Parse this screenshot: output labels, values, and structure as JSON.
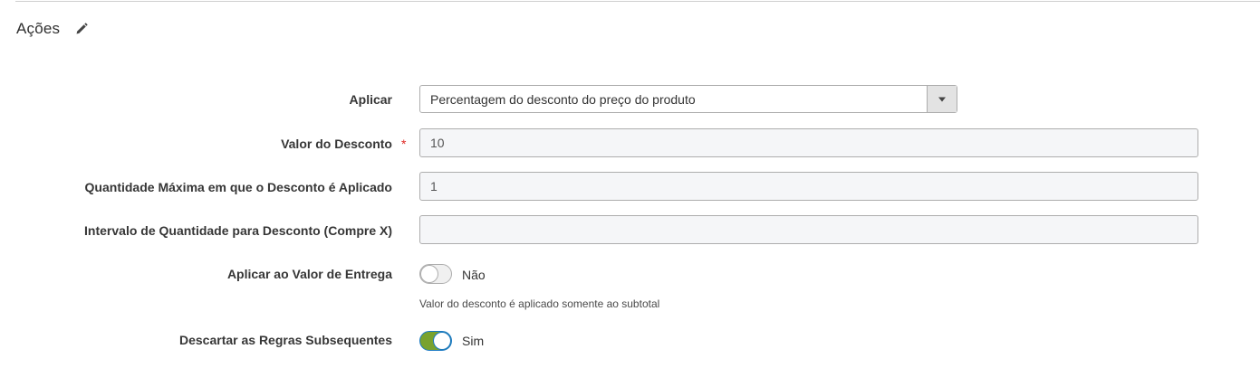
{
  "section": {
    "title": "Ações",
    "edit_icon": "pencil-icon"
  },
  "fields": {
    "apply": {
      "label": "Aplicar",
      "value": "Percentagem do desconto do preço do produto",
      "arrow_icon": "caret-down-icon"
    },
    "discount_amount": {
      "label": "Valor do Desconto",
      "required_mark": "*",
      "value": "10"
    },
    "max_qty": {
      "label": "Quantidade Máxima em que o Desconto é Aplicado",
      "value": "1"
    },
    "discount_step": {
      "label": "Intervalo de Quantidade para Desconto (Compre X)",
      "value": ""
    },
    "apply_to_shipping": {
      "label": "Aplicar ao Valor de Entrega",
      "state": "off",
      "state_label": "Não",
      "note": "Valor do desconto é aplicado somente ao subtotal"
    },
    "discard_subsequent": {
      "label": "Descartar as Regras Subsequentes",
      "state": "on",
      "state_label": "Sim"
    }
  },
  "colors": {
    "toggle_on": "#79a22e",
    "toggle_on_border": "#1979c3",
    "required": "#e02b27"
  }
}
